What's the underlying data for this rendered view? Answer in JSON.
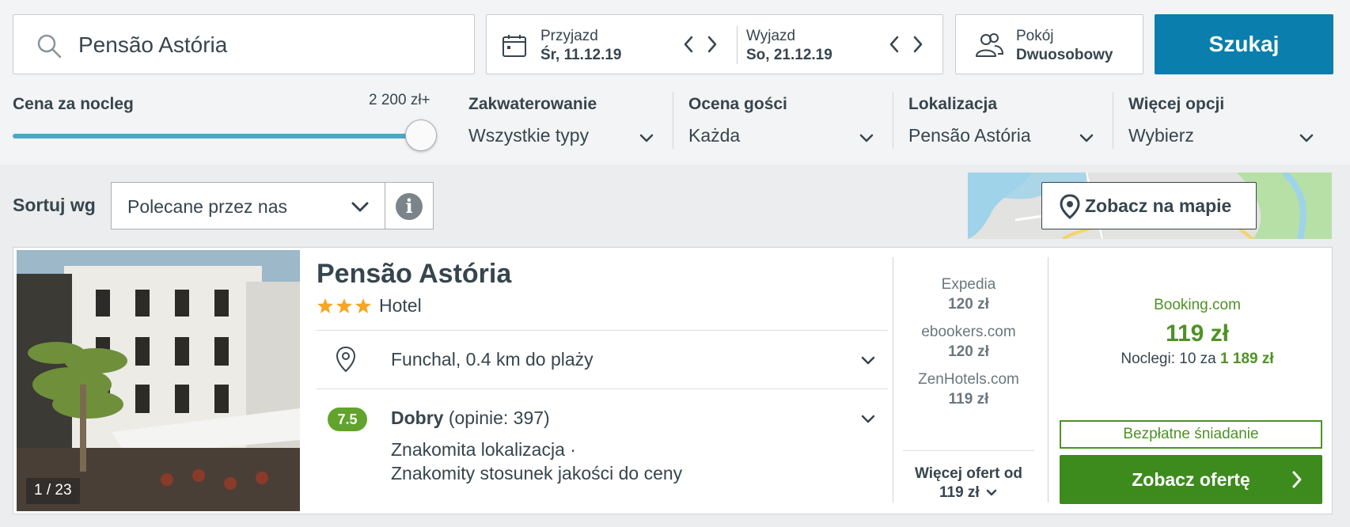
{
  "search": {
    "query": "Pensão Astória"
  },
  "dates": {
    "checkin_label": "Przyjazd",
    "checkin_value": "Śr, 11.12.19",
    "checkout_label": "Wyjazd",
    "checkout_value": "So, 21.12.19"
  },
  "guests": {
    "label": "Pokój",
    "value": "Dwuosobowy"
  },
  "search_button": "Szukaj",
  "filters": {
    "price": {
      "title": "Cena za nocleg",
      "max_label": "2 200 zł+",
      "slider_value_fraction": 1.0
    },
    "items": [
      {
        "title": "Zakwaterowanie",
        "value": "Wszystkie typy"
      },
      {
        "title": "Ocena gości",
        "value": "Każda"
      },
      {
        "title": "Lokalizacja",
        "value": "Pensão Astória"
      },
      {
        "title": "Więcej opcji",
        "value": "Wybierz"
      }
    ]
  },
  "sort": {
    "label": "Sortuj wg",
    "value": "Polecane przez nas"
  },
  "map": {
    "button_label": "Zobacz na mapie"
  },
  "result": {
    "photo_counter": "1 / 23",
    "name": "Pensão Astória",
    "stars": 3,
    "type": "Hotel",
    "location": "Funchal, 0.4 km do plaży",
    "rating": {
      "score": "7.5",
      "label": "Dobry",
      "reviews": "(opinie: 397)",
      "line1": "Znakomita lokalizacja ·",
      "line2": "Znakomity stosunek jakości do ceny"
    },
    "partners": [
      {
        "name": "Expedia",
        "price": "120 zł"
      },
      {
        "name": "ebookers.com",
        "price": "120 zł"
      },
      {
        "name": "ZenHotels.com",
        "price": "119 zł"
      }
    ],
    "more_offers_line1": "Więcej ofert od",
    "more_offers_line2": "119 zł",
    "best": {
      "partner": "Booking.com",
      "price": "119 zł",
      "nights_prefix": "Noclegi: 10 za",
      "nights_total": "1 189 zł"
    },
    "breakfast": "Bezpłatne śniadanie",
    "deal_button": "Zobacz ofertę"
  },
  "colors": {
    "accent": "#0a7eac",
    "green": "#3d8b1d",
    "rating_green": "#61a32d",
    "text": "#37454d"
  }
}
